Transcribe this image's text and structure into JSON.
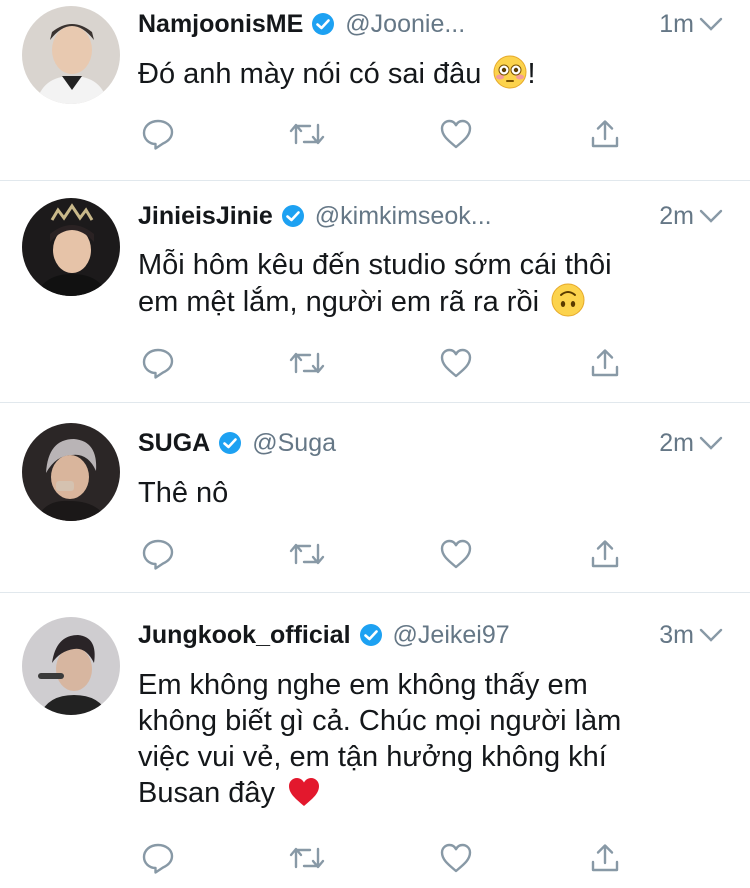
{
  "colors": {
    "verified": "#1da1f2",
    "icon": "#8899a6",
    "text": "#14171a",
    "muted": "#657786"
  },
  "tweets": [
    {
      "name": "NamjoonisME",
      "handle": "@Joonie...",
      "time": "1m",
      "lines": [
        "Đó anh mày nói có sai đâu"
      ],
      "trailing_text": "!",
      "emoji": "flushed-face"
    },
    {
      "name": "JinieisJinie",
      "handle": "@kimkimseok...",
      "time": "2m",
      "lines": [
        "Mỗi hôm kêu đến studio sớm cái thôi",
        "em mệt lắm, người em rã ra rồi"
      ],
      "emoji": "upside-down-face"
    },
    {
      "name": "SUGA",
      "handle": "@Suga",
      "time": "2m",
      "lines": [
        "Thê nô"
      ]
    },
    {
      "name": "Jungkook_official",
      "handle": "@Jeikei97",
      "time": "3m",
      "lines": [
        "Em không nghe em không thấy em",
        "không biết gì cả. Chúc mọi người làm",
        "việc vui vẻ, em tận hưởng không khí",
        "Busan đây"
      ],
      "emoji": "red-heart"
    }
  ]
}
